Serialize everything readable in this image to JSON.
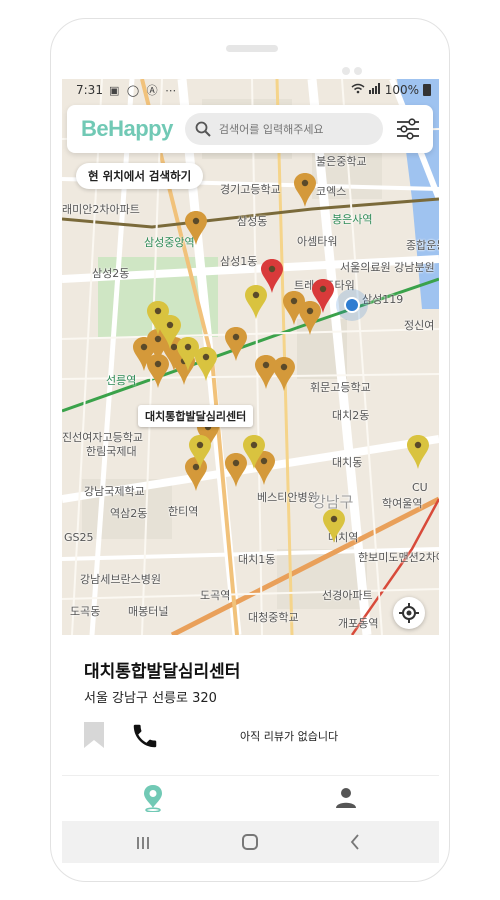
{
  "status_bar": {
    "time": "7:31",
    "notification_icons": "▣ ◯ Ⓐ ⋯",
    "battery": "100%"
  },
  "app_bar": {
    "logo": "BeHappy",
    "search_placeholder": "검색어를 입력해주세요"
  },
  "map": {
    "search_here_label": "현 위치에서 검색하기",
    "selected_callout": "대치통합발달심리센터",
    "labels": {
      "l1": "불은중학교",
      "l2": "경기고등학교",
      "l3": "코엑스",
      "l4": "삼성중앙역",
      "l5": "삼성1동",
      "l6": "선릉역",
      "l7": "대치동",
      "l8": "대치1동",
      "l9": "강남구",
      "l10": "역삼2동",
      "l11": "한티역",
      "l12": "도곡역",
      "l13": "도곡동",
      "l14": "서울의료원 강남분원",
      "l15": "삼성119",
      "l16": "휘문고등학교",
      "l17": "대치2동",
      "l18": "베스티안병원",
      "l19": "학여울역",
      "l20": "대치역",
      "l21": "한보미도맨션2차아",
      "l22": "선경아파트",
      "l23": "대청중학교",
      "l24": "개포동역",
      "l25": "강남세브란스병원",
      "l26": "매봉터널",
      "l27": "진선여자고등학교",
      "l28": "한림국제대",
      "l29": "강남국제학교",
      "l30": "아셈타워",
      "l31": "봉은사역",
      "l32": "삼성2동",
      "l33": "GS25",
      "l34": "CU",
      "l35": "래미안2차아파트",
      "l36": "종합운동",
      "l37": "정신여",
      "l38": "삼성동",
      "l39": "CU",
      "l40": "봉은초등학교",
      "l41": "트레이드타워",
      "l42": "봉은사역",
      "l43": "삼성1동"
    }
  },
  "detail": {
    "name": "대치통합발달심리센터",
    "address": "서울 강남구 선릉로 320",
    "review_text": "아직 리뷰가 없습니다"
  },
  "colors": {
    "brand": "#71c9b5",
    "pin_yellow": "#d9c33f",
    "pin_orange": "#d4993a",
    "pin_red": "#d93a3a",
    "current_location": "#2f7dd1"
  }
}
